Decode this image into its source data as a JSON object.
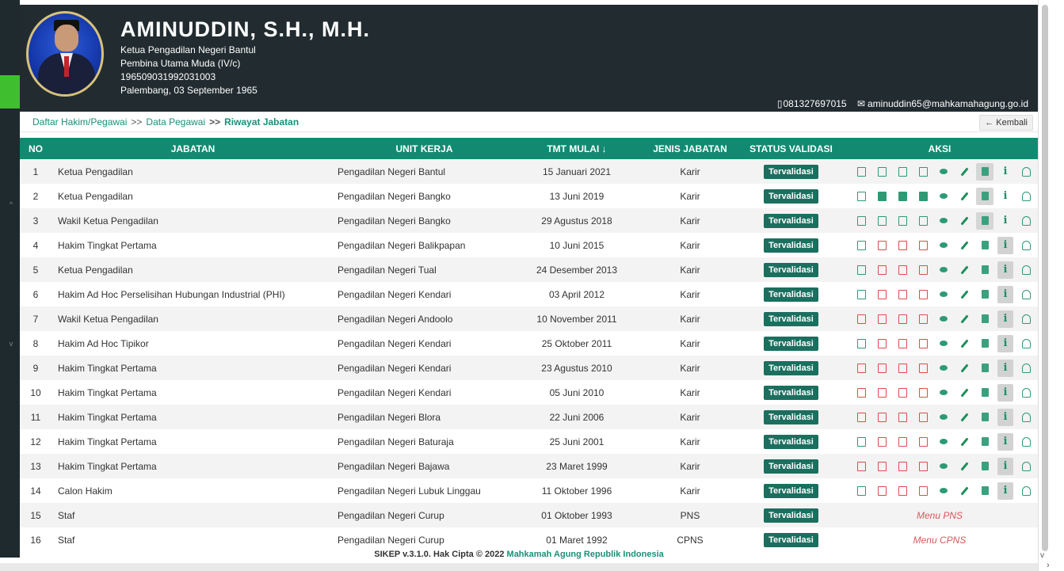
{
  "profile": {
    "name": "AMINUDDIN, S.H., M.H.",
    "position": "Ketua Pengadilan Negeri Bantul",
    "rank": "Pembina Utama Muda (IV/c)",
    "nip": "196509031992031003",
    "birth": "Palembang, 03 September 1965",
    "phone": "081327697015",
    "email": "aminuddin65@mahkamahagung.go.id"
  },
  "breadcrumb": {
    "item1": "Daftar Hakim/Pegawai",
    "sep1": ">>",
    "item2": "Data Pegawai",
    "sep2": ">>",
    "current": "Riwayat Jabatan",
    "back_label": "← Kembali"
  },
  "table": {
    "headers": {
      "no": "NO",
      "jabatan": "JABATAN",
      "unit": "UNIT KERJA",
      "tmt": "TMT MULAI ↓",
      "jenis": "JENIS JABATAN",
      "status": "STATUS VALIDASI",
      "aksi": "AKSI"
    },
    "rows": [
      {
        "no": "1",
        "jabatan": "Ketua Pengadilan",
        "unit": "Pengadilan Negeri Bantul",
        "tmt": "15 Januari 2021",
        "jenis": "Karir",
        "status": "Tervalidasi"
      },
      {
        "no": "2",
        "jabatan": "Ketua Pengadilan",
        "unit": "Pengadilan Negeri Bangko",
        "tmt": "13 Juni 2019",
        "jenis": "Karir",
        "status": "Tervalidasi"
      },
      {
        "no": "3",
        "jabatan": "Wakil Ketua Pengadilan",
        "unit": "Pengadilan Negeri Bangko",
        "tmt": "29 Agustus 2018",
        "jenis": "Karir",
        "status": "Tervalidasi"
      },
      {
        "no": "4",
        "jabatan": "Hakim Tingkat Pertama",
        "unit": "Pengadilan Negeri Balikpapan",
        "tmt": "10 Juni 2015",
        "jenis": "Karir",
        "status": "Tervalidasi"
      },
      {
        "no": "5",
        "jabatan": "Ketua Pengadilan",
        "unit": "Pengadilan Negeri Tual",
        "tmt": "24 Desember 2013",
        "jenis": "Karir",
        "status": "Tervalidasi"
      },
      {
        "no": "6",
        "jabatan": "Hakim Ad Hoc Perselisihan Hubungan Industrial (PHI)",
        "unit": "Pengadilan Negeri Kendari",
        "tmt": "03 April 2012",
        "jenis": "Karir",
        "status": "Tervalidasi"
      },
      {
        "no": "7",
        "jabatan": "Wakil Ketua Pengadilan",
        "unit": "Pengadilan Negeri Andoolo",
        "tmt": "10 November 2011",
        "jenis": "Karir",
        "status": "Tervalidasi"
      },
      {
        "no": "8",
        "jabatan": "Hakim Ad Hoc Tipikor",
        "unit": "Pengadilan Negeri Kendari",
        "tmt": "25 Oktober 2011",
        "jenis": "Karir",
        "status": "Tervalidasi"
      },
      {
        "no": "9",
        "jabatan": "Hakim Tingkat Pertama",
        "unit": "Pengadilan Negeri Kendari",
        "tmt": "23 Agustus 2010",
        "jenis": "Karir",
        "status": "Tervalidasi"
      },
      {
        "no": "10",
        "jabatan": "Hakim Tingkat Pertama",
        "unit": "Pengadilan Negeri Kendari",
        "tmt": "05 Juni 2010",
        "jenis": "Karir",
        "status": "Tervalidasi"
      },
      {
        "no": "11",
        "jabatan": "Hakim Tingkat Pertama",
        "unit": "Pengadilan Negeri Blora",
        "tmt": "22 Juni 2006",
        "jenis": "Karir",
        "status": "Tervalidasi"
      },
      {
        "no": "12",
        "jabatan": "Hakim Tingkat Pertama",
        "unit": "Pengadilan Negeri Baturaja",
        "tmt": "25 Juni 2001",
        "jenis": "Karir",
        "status": "Tervalidasi"
      },
      {
        "no": "13",
        "jabatan": "Hakim Tingkat Pertama",
        "unit": "Pengadilan Negeri Bajawa",
        "tmt": "23 Maret 1999",
        "jenis": "Karir",
        "status": "Tervalidasi"
      },
      {
        "no": "14",
        "jabatan": "Calon Hakim",
        "unit": "Pengadilan Negeri Lubuk Linggau",
        "tmt": "11 Oktober 1996",
        "jenis": "Karir",
        "status": "Tervalidasi"
      },
      {
        "no": "15",
        "jabatan": "Staf",
        "unit": "Pengadilan Negeri Curup",
        "tmt": "01 Oktober 1993",
        "jenis": "PNS",
        "status": "Tervalidasi"
      },
      {
        "no": "16",
        "jabatan": "Staf",
        "unit": "Pengadilan Negeri Curup",
        "tmt": "01 Maret 1992",
        "jenis": "CPNS",
        "status": "Tervalidasi"
      }
    ],
    "menu_pns": "Menu PNS",
    "menu_cpns": "Menu CPNS"
  },
  "footer": {
    "text": "SIKEP v.3.1.0. Hak Cipta © 2022",
    "brand": "Mahkamah Agung Republik Indonesia"
  },
  "colors": {
    "header_bg": "#222c30",
    "table_header": "#128a72",
    "badge": "#1b6f5f",
    "link": "#1b8f7a",
    "pdf_red": "#e24a4a",
    "pdf_green": "#2e9a73",
    "menu_link": "#d45a5a"
  }
}
